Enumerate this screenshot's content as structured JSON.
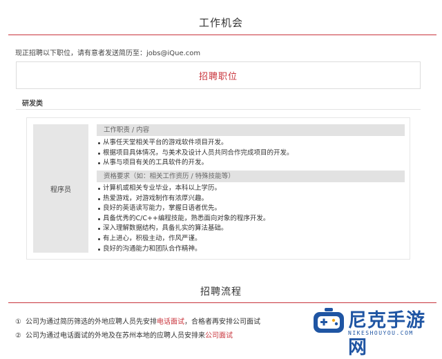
{
  "header": {
    "title": "工作机会"
  },
  "intro": {
    "text": "现正招聘以下职位，请有意者发送简历至：jobs@iQue.com"
  },
  "recruit": {
    "title": "招聘职位"
  },
  "category": {
    "label": "研发类"
  },
  "job": {
    "name": "程序员",
    "duties_heading": "工作职责 / 内容",
    "duties": [
      "从事任天堂相关平台的游戏软件项目开发。",
      "根据项目具体情况，与美术及设计人员共同合作完成项目的开发。",
      "从事与项目有关的工具软件的开发。"
    ],
    "requirements_heading": "资格要求（如：相关工作资历 / 特殊技能等）",
    "requirements": [
      "计算机或相关专业毕业，本科以上学历。",
      "热爱游戏，对游戏制作有浓厚兴趣。",
      "良好的英语读写能力，掌握日语者优先。",
      "具备优秀的C/C++编程技能，熟悉面向对象的程序开发。",
      "深入理解数据结构，具备扎实的算法基础。",
      "有上进心，积极主动，作风严谨。",
      "良好的沟通能力和团队合作精神。"
    ]
  },
  "process": {
    "title": "招聘流程",
    "steps": [
      {
        "num": "①",
        "pre": "公司为通过简历筛选的外地应聘人员先安排",
        "highlight": "电话面试",
        "post": "，合格者再安排公司面试"
      },
      {
        "num": "②",
        "pre": "公司为通过电话面试的外地及在苏州本地的应聘人员安排来",
        "highlight": "公司面试",
        "post": ""
      }
    ]
  },
  "watermark": {
    "brand": "尼克手游网",
    "sub": "NIKESHOUYOU.COM",
    "logo_icon": "gamepad-logo-icon"
  },
  "colors": {
    "accent": "#c8333b",
    "watermark": "#1f55a3",
    "section_bg": "#e2e2e2"
  }
}
